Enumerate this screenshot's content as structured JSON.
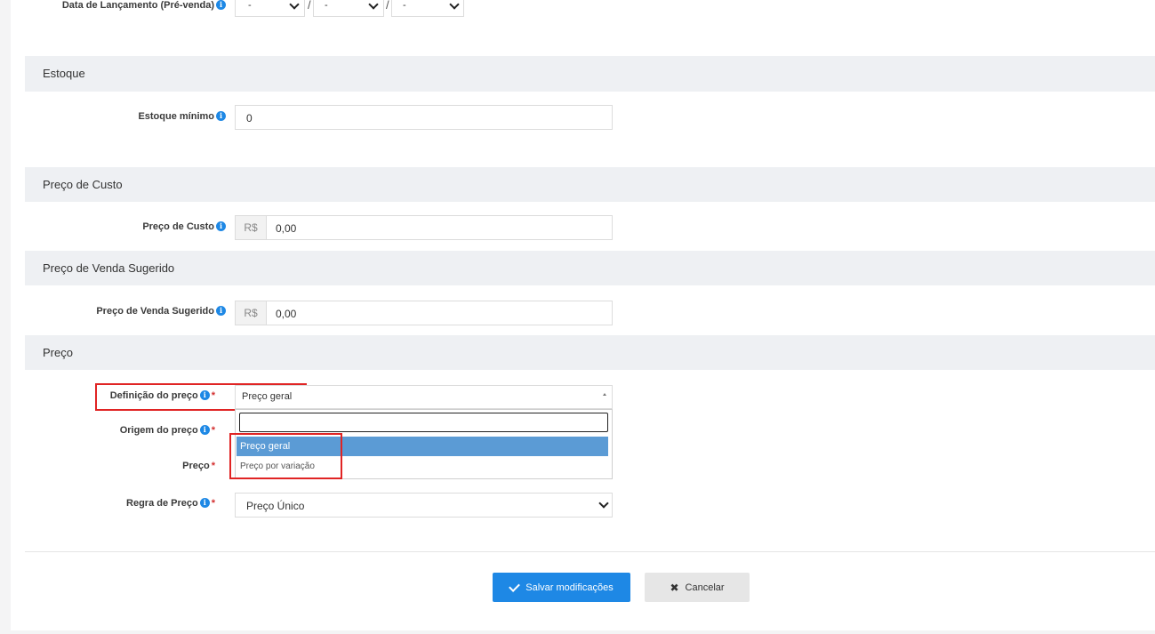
{
  "release_date": {
    "label": "Data de Lançamento (Pré-venda)",
    "day": "-",
    "month": "-",
    "year": "-",
    "separator": "/"
  },
  "sections": {
    "stock": "Estoque",
    "cost_price": "Preço de Custo",
    "suggested_price": "Preço de Venda Sugerido",
    "price": "Preço"
  },
  "fields": {
    "min_stock": {
      "label": "Estoque mínimo",
      "value": "0"
    },
    "cost_price": {
      "label": "Preço de Custo",
      "prefix": "R$",
      "value": "0,00"
    },
    "suggested_price": {
      "label": "Preço de Venda Sugerido",
      "prefix": "R$",
      "value": "0,00"
    },
    "price_definition": {
      "label": "Definição do preço",
      "value": "Preço geral",
      "search_value": "",
      "options": [
        "Preço geral",
        "Preço por variação"
      ]
    },
    "price_origin": {
      "label": "Origem do preço"
    },
    "price": {
      "label": "Preço"
    },
    "price_rule": {
      "label": "Regra de Preço",
      "value": "Preço Único"
    }
  },
  "required_mark": "*",
  "info_glyph": "i",
  "actions": {
    "save": "Salvar modificações",
    "cancel": "Cancelar"
  },
  "colors": {
    "primary": "#1e88e5",
    "highlight": "#e02424",
    "selected_option": "#5b9bd5",
    "section_bg": "#eef0f3"
  }
}
